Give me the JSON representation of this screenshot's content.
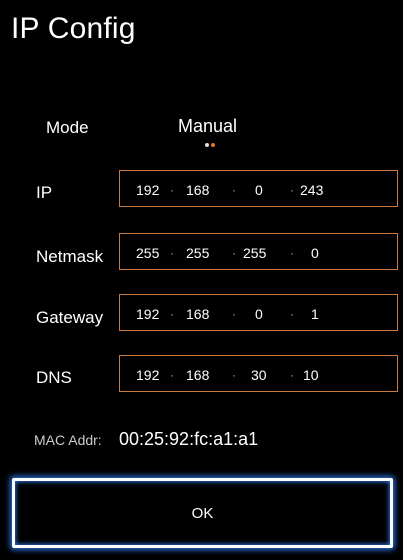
{
  "title": "IP Config",
  "mode": {
    "label": "Mode",
    "value": "Manual"
  },
  "fields": {
    "ip": {
      "label": "IP",
      "octets": [
        "192",
        "168",
        "0",
        "243"
      ]
    },
    "netmask": {
      "label": "Netmask",
      "octets": [
        "255",
        "255",
        "255",
        "0"
      ]
    },
    "gateway": {
      "label": "Gateway",
      "octets": [
        "192",
        "168",
        "0",
        "1"
      ]
    },
    "dns": {
      "label": "DNS",
      "octets": [
        "192",
        "168",
        "30",
        "10"
      ]
    }
  },
  "separator": "·",
  "mac": {
    "label": "MAC Addr:",
    "value": "00:25:92:fc:a1:a1"
  },
  "ok_label": "OK",
  "colors": {
    "background": "#000000",
    "field_border": "#c97a3f",
    "focus_glow": "#2a6fd6",
    "mode_indicator_active": "#e8722a"
  }
}
